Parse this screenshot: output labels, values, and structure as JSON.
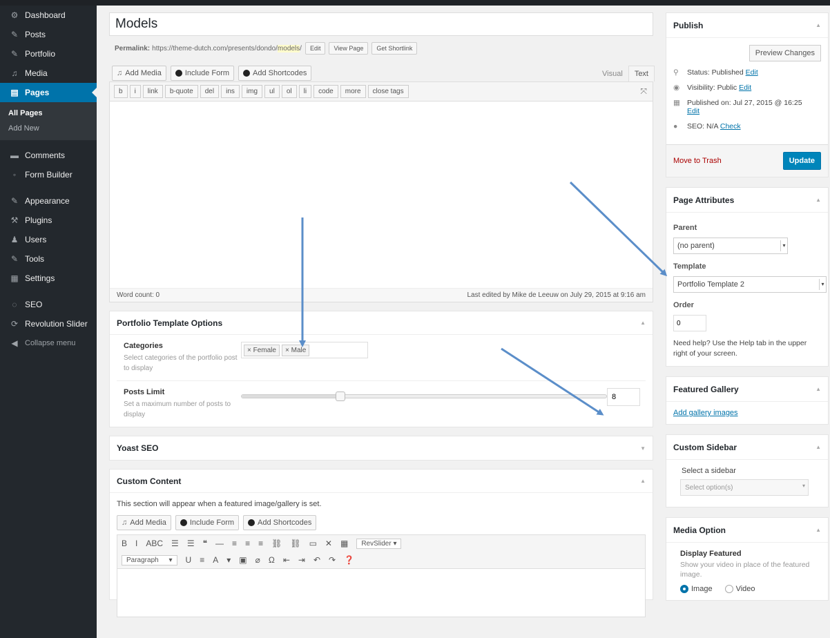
{
  "sidebar": {
    "items": [
      {
        "label": "Dashboard",
        "icon": "⚙"
      },
      {
        "label": "Posts",
        "icon": "✎"
      },
      {
        "label": "Portfolio",
        "icon": "✎"
      },
      {
        "label": "Media",
        "icon": "♫"
      },
      {
        "label": "Pages",
        "icon": "▤"
      }
    ],
    "submenu": [
      "All Pages",
      "Add New"
    ],
    "items2": [
      {
        "label": "Comments",
        "icon": "▬"
      },
      {
        "label": "Form Builder",
        "icon": "◦"
      }
    ],
    "items3": [
      {
        "label": "Appearance",
        "icon": "✎"
      },
      {
        "label": "Plugins",
        "icon": "⚒"
      },
      {
        "label": "Users",
        "icon": "♟"
      },
      {
        "label": "Tools",
        "icon": "✎"
      },
      {
        "label": "Settings",
        "icon": "▦"
      }
    ],
    "items4": [
      {
        "label": "SEO",
        "icon": "◌"
      },
      {
        "label": "Revolution Slider",
        "icon": "⟳"
      },
      {
        "label": "Collapse menu",
        "icon": "◀"
      }
    ]
  },
  "post": {
    "title": "Models",
    "permalink_label": "Permalink:",
    "permalink_base": "https://theme-dutch.com/presents/dondo/",
    "permalink_slug": "models",
    "permalink_end": "/",
    "edit_btn": "Edit",
    "view_btn": "View Page",
    "shortlink_btn": "Get Shortlink"
  },
  "editor": {
    "add_media": "Add Media",
    "include_form": "Include Form",
    "add_shortcodes": "Add Shortcodes",
    "tab_visual": "Visual",
    "tab_text": "Text",
    "quicktags": [
      "b",
      "i",
      "link",
      "b-quote",
      "del",
      "ins",
      "img",
      "ul",
      "ol",
      "li",
      "code",
      "more",
      "close tags"
    ],
    "word_count": "Word count: 0",
    "last_edited": "Last edited by Mike de Leeuw on July 29, 2015 at 9:16 am"
  },
  "portfolio_options": {
    "title": "Portfolio Template Options",
    "categories_label": "Categories",
    "categories_desc": "Select categories of the portfolio post to display",
    "tags": [
      "Female",
      "Male"
    ],
    "posts_limit_label": "Posts Limit",
    "posts_limit_desc": "Set a maximum number of posts to display",
    "posts_limit_value": "8",
    "slider_fraction": 0.27
  },
  "yoast": {
    "title": "Yoast SEO"
  },
  "custom_content": {
    "title": "Custom Content",
    "desc": "This section will appear when a featured image/gallery is set.",
    "add_media": "Add Media",
    "include_form": "Include Form",
    "add_shortcodes": "Add Shortcodes",
    "row1": [
      "B",
      "I",
      "ABC",
      "☰",
      "☰",
      "❝",
      "—",
      "≡",
      "≡",
      "≡",
      "⛓",
      "⛓",
      "▭",
      "✕",
      "▦"
    ],
    "revslider": "RevSlider ▾",
    "paragraph": "Paragraph",
    "row2": [
      "U",
      "≡",
      "A",
      "▾",
      "▣",
      "⌀",
      "Ω",
      "⇤",
      "⇥",
      "↶",
      "↷",
      "❓"
    ]
  },
  "publish": {
    "title": "Publish",
    "preview": "Preview Changes",
    "status": "Status: Published",
    "visibility": "Visibility: Public",
    "published_on": "Published on: Jul 27, 2015 @ 16:25",
    "seo": "SEO: N/A",
    "edit": "Edit",
    "check": "Check",
    "trash": "Move to Trash",
    "update": "Update"
  },
  "page_attributes": {
    "title": "Page Attributes",
    "parent_label": "Parent",
    "parent_value": "(no parent)",
    "template_label": "Template",
    "template_value": "Portfolio Template 2",
    "order_label": "Order",
    "order_value": "0",
    "help": "Need help? Use the Help tab in the upper right of your screen."
  },
  "featured_gallery": {
    "title": "Featured Gallery",
    "link": "Add gallery images"
  },
  "custom_sidebar": {
    "title": "Custom Sidebar",
    "label": "Select a sidebar",
    "placeholder": "Select option(s)"
  },
  "media_option": {
    "title": "Media Option",
    "label": "Display Featured",
    "desc": "Show your video in place of the featured image.",
    "opt_image": "Image",
    "opt_video": "Video"
  },
  "colors": {
    "accent": "#0073aa",
    "sidebar": "#23282d",
    "arrow": "#5b8ec9"
  }
}
